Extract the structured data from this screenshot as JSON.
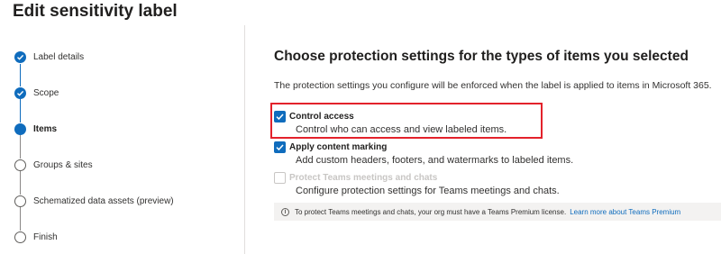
{
  "page": {
    "title": "Edit sensitivity label"
  },
  "wizard": {
    "steps": [
      {
        "label": "Label details",
        "state": "done"
      },
      {
        "label": "Scope",
        "state": "done"
      },
      {
        "label": "Items",
        "state": "current"
      },
      {
        "label": "Groups & sites",
        "state": "todo"
      },
      {
        "label": "Schematized data assets (preview)",
        "state": "todo"
      },
      {
        "label": "Finish",
        "state": "todo"
      }
    ]
  },
  "main": {
    "heading": "Choose protection settings for the types of items you selected",
    "description": "The protection settings you configure will be enforced when the label is applied to items in Microsoft 365.",
    "options": [
      {
        "label": "Control access",
        "description": "Control who can access and view labeled items.",
        "checked": true,
        "disabled": false
      },
      {
        "label": "Apply content marking",
        "description": "Add custom headers, footers, and watermarks to labeled items.",
        "checked": true,
        "disabled": false
      },
      {
        "label": "Protect Teams meetings and chats",
        "description": "Configure protection settings for Teams meetings and chats.",
        "checked": false,
        "disabled": true
      }
    ],
    "info": {
      "icon": "info-icon",
      "text": "To protect Teams meetings and chats, your org must have a Teams Premium license.",
      "link": "Learn more about Teams Premium"
    }
  },
  "colors": {
    "accent": "#0f6cbd",
    "highlight": "#e3222b",
    "disabled": "#c8c6c4"
  }
}
